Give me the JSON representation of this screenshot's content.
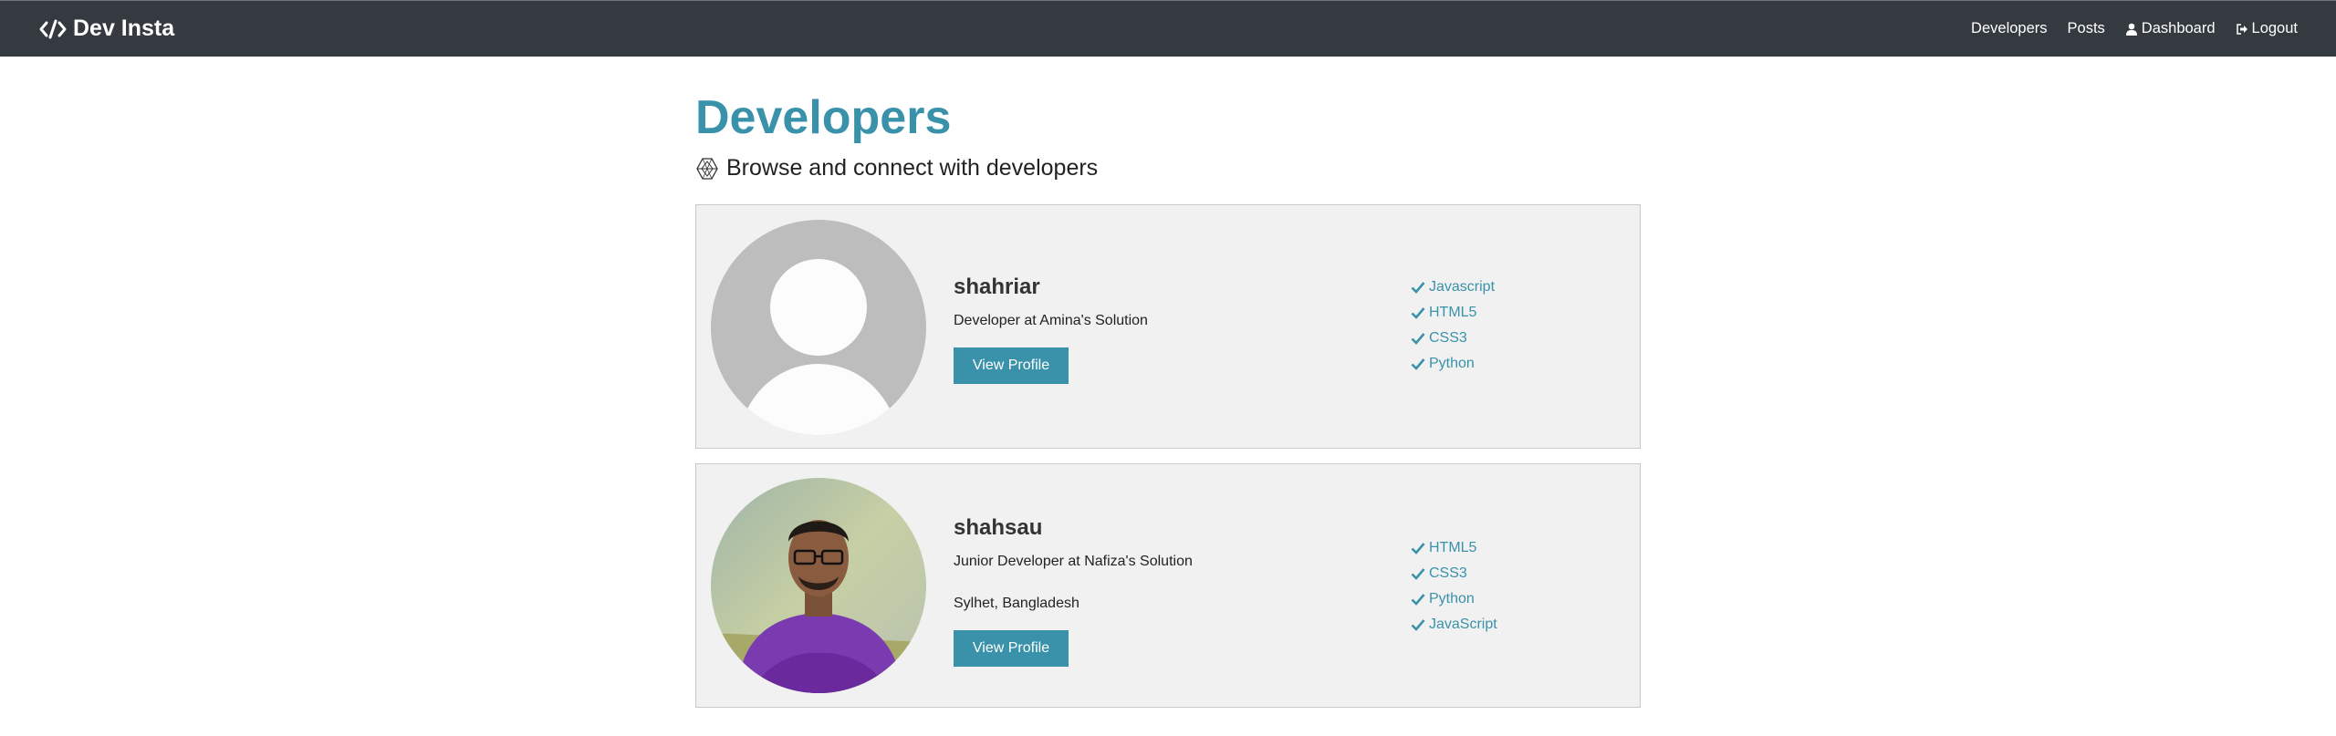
{
  "navbar": {
    "brand": "Dev Insta",
    "links": {
      "developers": "Developers",
      "posts": "Posts",
      "dashboard": "Dashboard",
      "logout": "Logout"
    }
  },
  "page": {
    "title": "Developers",
    "lead": "Browse and connect with developers"
  },
  "profiles": [
    {
      "name": "shahriar",
      "role": "Developer at Amina's Solution",
      "location": "",
      "button": "View Profile",
      "avatar": "default-avatar",
      "skills": [
        "Javascript",
        "HTML5",
        "CSS3",
        "Python"
      ]
    },
    {
      "name": "shahsau",
      "role": "Junior Developer at Nafiza's Solution",
      "location": "Sylhet, Bangladesh",
      "button": "View Profile",
      "avatar": "photo-avatar",
      "skills": [
        "HTML5",
        "CSS3",
        "Python",
        "JavaScript"
      ]
    }
  ],
  "colors": {
    "navbar": "#343a40",
    "primary": "#3a92aa",
    "card_bg": "#f1f1f1"
  }
}
